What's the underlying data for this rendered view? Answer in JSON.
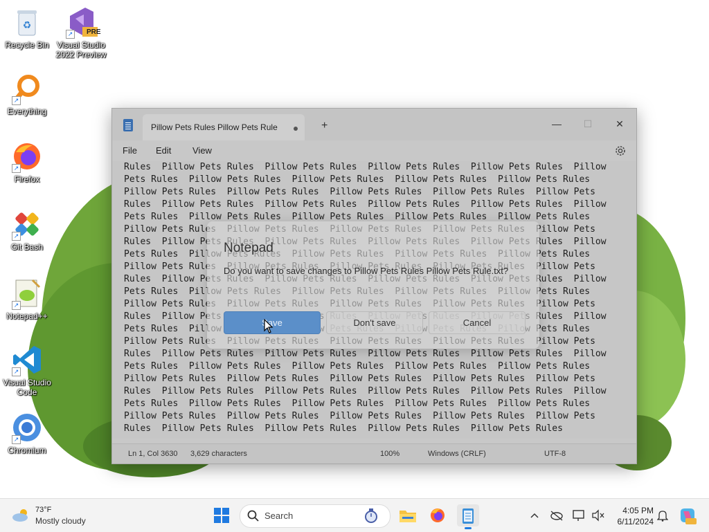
{
  "desktop": {
    "icons": [
      {
        "label": "Recycle Bin"
      },
      {
        "label": "Visual Studio 2022 Preview",
        "badge": "PRE"
      },
      {
        "label": "Everything"
      },
      {
        "label": "Firefox"
      },
      {
        "label": "Git Bash"
      },
      {
        "label": "Notepad++"
      },
      {
        "label": "Visual Studio Code"
      },
      {
        "label": "Chromium"
      }
    ]
  },
  "notepad": {
    "tab_title": "Pillow Pets Rules  Pillow Pets Rule",
    "new_tab_symbol": "+",
    "window_controls": {
      "minimize": "—",
      "maximize": "☐",
      "close": "✕"
    },
    "menu": {
      "file": "File",
      "edit": "Edit",
      "view": "View"
    },
    "content_lines": [
      "Rules  Pillow Pets Rules  Pillow Pets Rules  Pillow Pets Rules  Pillow Pets Rules  Pillow",
      "Pets Rules  Pillow Pets Rules  Pillow Pets Rules  Pillow Pets Rules  Pillow Pets Rules",
      "Pillow Pets Rules  Pillow Pets Rules  Pillow Pets Rules  Pillow Pets Rules  Pillow Pets",
      "Rules  Pillow Pets Rules  Pillow Pets Rules  Pillow Pets Rules  Pillow Pets Rules  Pillow",
      "Pets Rules  Pillow Pets Rules  Pillow Pets Rules  Pillow Pets Rules  Pillow Pets Rules",
      "Pillow Pets Rules  Pillow Pets Rules  Pillow Pets Rules  Pillow Pets Rules  Pillow Pets",
      "Rules  Pillow Pets Rules  Pillow Pets Rules  Pillow Pets Rules  Pillow Pets Rules  Pillow",
      "Pets Rules  Pillow Pets Rules  Pillow Pets Rules  Pillow Pets Rules  Pillow Pets Rules",
      "Pillow Pets Rules  Pillow Pets Rules  Pillow Pets Rules  Pillow Pets Rules  Pillow Pets",
      "Rules  Pillow Pets Rules  Pillow Pets Rules  Pillow Pets Rules  Pillow Pets Rules  Pillow",
      "Pets Rules  Pillow Pets Rules  Pillow Pets Rules  Pillow Pets Rules  Pillow Pets Rules",
      "Pillow Pets Rules  Pillow Pets Rules  Pillow Pets Rules  Pillow Pets Rules  Pillow Pets",
      "Rules  Pillow Pets Rules  Pillow Pets Rules  Pillow Pets Rules  Pillow Pets Rules  Pillow",
      "Pets Rules  Pillow Pets Rules  Pillow Pets Rules  Pillow Pets Rules  Pillow Pets Rules",
      "Pillow Pets Rules  Pillow Pets Rules  Pillow Pets Rules  Pillow Pets Rules  Pillow Pets",
      "Rules  Pillow Pets Rules  Pillow Pets Rules  Pillow Pets Rules  Pillow Pets Rules  Pillow",
      "Pets Rules  Pillow Pets Rules  Pillow Pets Rules  Pillow Pets Rules  Pillow Pets Rules",
      "Pillow Pets Rules  Pillow Pets Rules  Pillow Pets Rules  Pillow Pets Rules  Pillow Pets",
      "Rules  Pillow Pets Rules  Pillow Pets Rules  Pillow Pets Rules  Pillow Pets Rules  Pillow",
      "Pets Rules  Pillow Pets Rules  Pillow Pets Rules  Pillow Pets Rules  Pillow Pets Rules",
      "Pillow Pets Rules  Pillow Pets Rules  Pillow Pets Rules  Pillow Pets Rules  Pillow Pets",
      "Rules  Pillow Pets Rules  Pillow Pets Rules  Pillow Pets Rules  Pillow Pets Rules"
    ],
    "status": {
      "position": "Ln 1, Col 3630",
      "characters": "3,629 characters",
      "zoom": "100%",
      "line_endings": "Windows (CRLF)",
      "encoding": "UTF-8"
    }
  },
  "dialog": {
    "title": "Notepad",
    "message": "Do you want to save changes to Pillow Pets Rules  Pillow Pets Rule.txt?",
    "buttons": {
      "save": "Save",
      "dont_save": "Don't save",
      "cancel": "Cancel"
    }
  },
  "taskbar": {
    "weather_temp": "73°F",
    "weather_desc": "Mostly cloudy",
    "search_label": "Search",
    "time": "4:05 PM",
    "date": "6/11/2024"
  },
  "colors": {
    "accent": "#5b8fc9",
    "wallpaper_green": "#7db443"
  }
}
